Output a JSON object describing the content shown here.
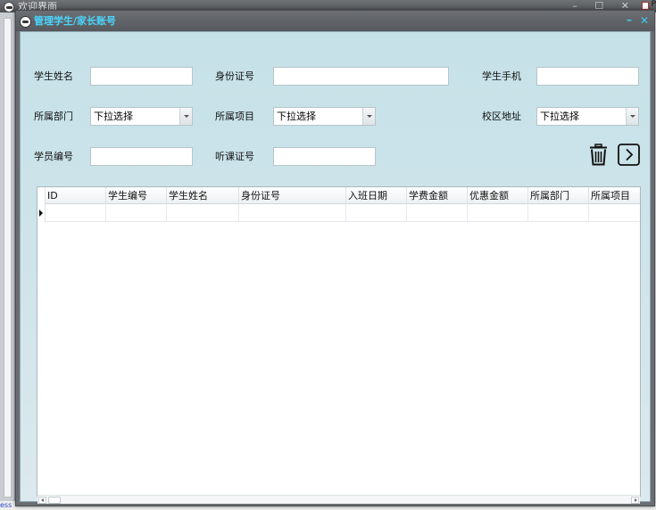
{
  "background_window": {
    "title": "欢迎界面",
    "controls": "– ☐ ✕",
    "corner_label": "P",
    "status_text": "ess"
  },
  "dialog": {
    "title": "管理学生/家长账号",
    "minimize": "–",
    "close": "✕"
  },
  "form": {
    "student_name_label": "学生姓名",
    "student_name_value": "",
    "id_number_label": "身份证号",
    "id_number_value": "",
    "student_phone_label": "学生手机",
    "student_phone_value": "",
    "department_label": "所属部门",
    "department_value": "下拉选择",
    "project_label": "所属项目",
    "project_value": "下拉选择",
    "campus_label": "校区地址",
    "campus_value": "下拉选择",
    "student_no_label": "学员编号",
    "student_no_value": "",
    "class_cert_label": "听课证号",
    "class_cert_value": ""
  },
  "actions": {
    "delete_icon": "trash-icon",
    "next_icon": "chevron-right-icon"
  },
  "grid": {
    "columns": [
      "ID",
      "学生编号",
      "学生姓名",
      "身份证号",
      "入班日期",
      "学费金额",
      "优惠金额",
      "所属部门",
      "所属项目"
    ],
    "rows": [
      [
        "",
        "",
        "",
        "",
        "",
        "",
        "",
        "",
        ""
      ]
    ]
  },
  "colors": {
    "title_accent": "#4ad6ff",
    "client_bg": "#c5e1e8",
    "titlebar": "#5f6266"
  }
}
